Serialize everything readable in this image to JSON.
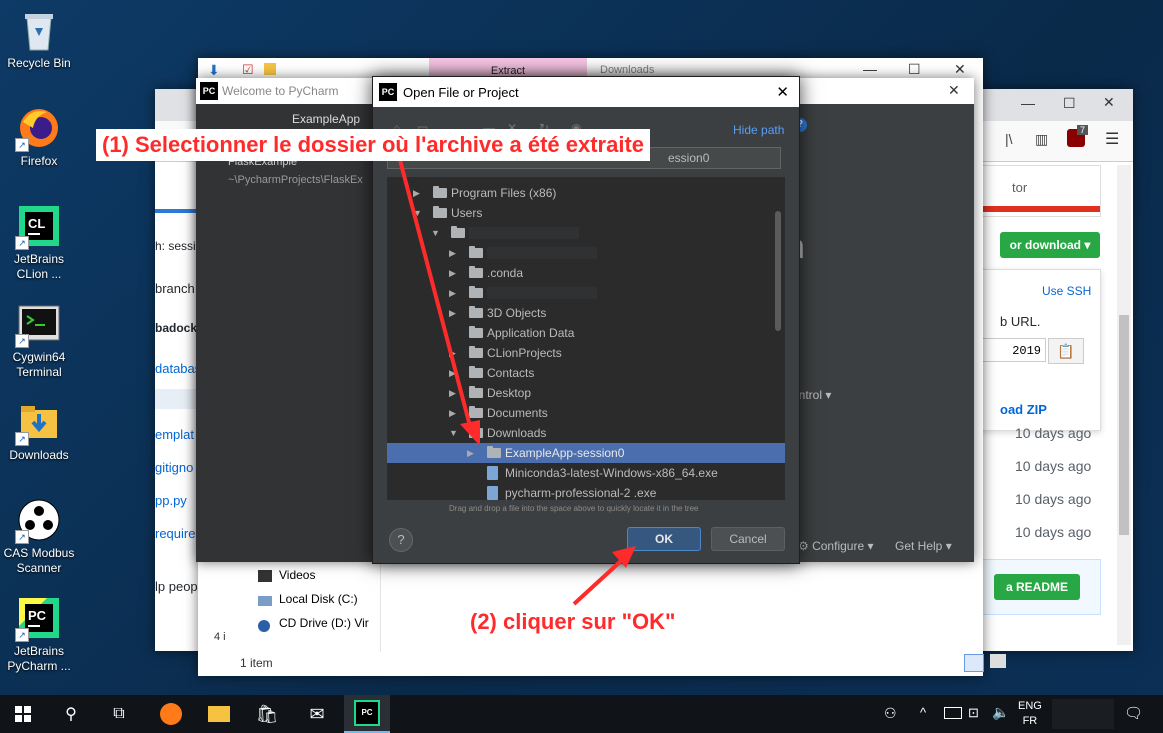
{
  "desktop_icons": [
    {
      "label": "Recycle Bin",
      "icon": "recycle-bin-icon"
    },
    {
      "label": "Firefox",
      "icon": "firefox-icon"
    },
    {
      "label": "JetBrains CLion ...",
      "icon": "clion-icon"
    },
    {
      "label": "Cygwin64 Terminal",
      "icon": "terminal-icon"
    },
    {
      "label": "Downloads",
      "icon": "folder-download-icon"
    },
    {
      "label": "CAS Modbus Scanner",
      "icon": "modbus-icon"
    },
    {
      "label": "JetBrains PyCharm ...",
      "icon": "pycharm-icon"
    }
  ],
  "explorer": {
    "tab_extract": "Extract",
    "tab_downloads": "Downloads",
    "nav_items": [
      "Videos",
      "Local Disk (C:)",
      "CD Drive (D:) Vir"
    ],
    "status": "1 item",
    "left_count": "4 i"
  },
  "github": {
    "left_fragments": [
      "h: sessi",
      "branch",
      "badock",
      "databas",
      "emplat",
      "gitigno",
      "pp.py",
      "requirer",
      "lp peop"
    ],
    "header_text": "tor",
    "clone_button": "or download",
    "use_ssh": "Use SSH",
    "web_url_text": "b URL.",
    "year_text": "2019",
    "download_zip": "oad ZIP",
    "dates": [
      "10 days ago",
      "10 days ago",
      "10 days ago",
      "10 days ago"
    ],
    "readme_button": "a README",
    "ublock_count": "7"
  },
  "welcome": {
    "title": "Welcome to PyCharm",
    "project_name": "ExampleApp",
    "recent_name": "FlaskExample",
    "recent_path": "~\\PycharmProjects\\FlaskEx",
    "version_fragment": "n",
    "control_fragment": "ontrol",
    "configure": "Configure",
    "get_help": "Get Help"
  },
  "dialog": {
    "title": "Open File or Project",
    "hide_path": "Hide path",
    "path_fragment": "ession0",
    "hint": "Drag and drop a file into the space above to quickly locate it in the tree",
    "ok": "OK",
    "cancel": "Cancel",
    "help": "?",
    "tree": [
      {
        "label": "Program Files (x86)",
        "depth": 1,
        "arrow": "right",
        "type": "folder"
      },
      {
        "label": "Users",
        "depth": 1,
        "arrow": "down",
        "type": "folder"
      },
      {
        "label": "",
        "depth": 2,
        "arrow": "down",
        "type": "folder"
      },
      {
        "label": "",
        "depth": 3,
        "arrow": "right",
        "type": "folder"
      },
      {
        "label": ".conda",
        "depth": 3,
        "arrow": "right",
        "type": "folder"
      },
      {
        "label": "",
        "depth": 3,
        "arrow": "right",
        "type": "folder"
      },
      {
        "label": "3D Objects",
        "depth": 3,
        "arrow": "right",
        "type": "folder"
      },
      {
        "label": "Application Data",
        "depth": 3,
        "arrow": "",
        "type": "folder"
      },
      {
        "label": "CLionProjects",
        "depth": 3,
        "arrow": "right",
        "type": "folder"
      },
      {
        "label": "Contacts",
        "depth": 3,
        "arrow": "right",
        "type": "folder"
      },
      {
        "label": "Desktop",
        "depth": 3,
        "arrow": "right",
        "type": "folder"
      },
      {
        "label": "Documents",
        "depth": 3,
        "arrow": "right",
        "type": "folder"
      },
      {
        "label": "Downloads",
        "depth": 3,
        "arrow": "down",
        "type": "folder"
      },
      {
        "label": "ExampleApp-session0",
        "depth": 4,
        "arrow": "right",
        "type": "folder",
        "selected": true
      },
      {
        "label": "Miniconda3-latest-Windows-x86_64.exe",
        "depth": 4,
        "arrow": "",
        "type": "file"
      },
      {
        "label": "pycharm-professional-2      .exe",
        "depth": 4,
        "arrow": "",
        "type": "file"
      }
    ]
  },
  "annotations": {
    "step1": "(1) Selectionner le dossier où l'archive a été extraite",
    "step2": "(2) cliquer sur \"OK\""
  },
  "taskbar": {
    "lang_top": "ENG",
    "lang_bottom": "FR"
  },
  "colors": {
    "annotation": "#ff2b2b",
    "selection": "#4b6eaf",
    "dialog_bg": "#3c3f41",
    "taskbar": "#101418"
  }
}
